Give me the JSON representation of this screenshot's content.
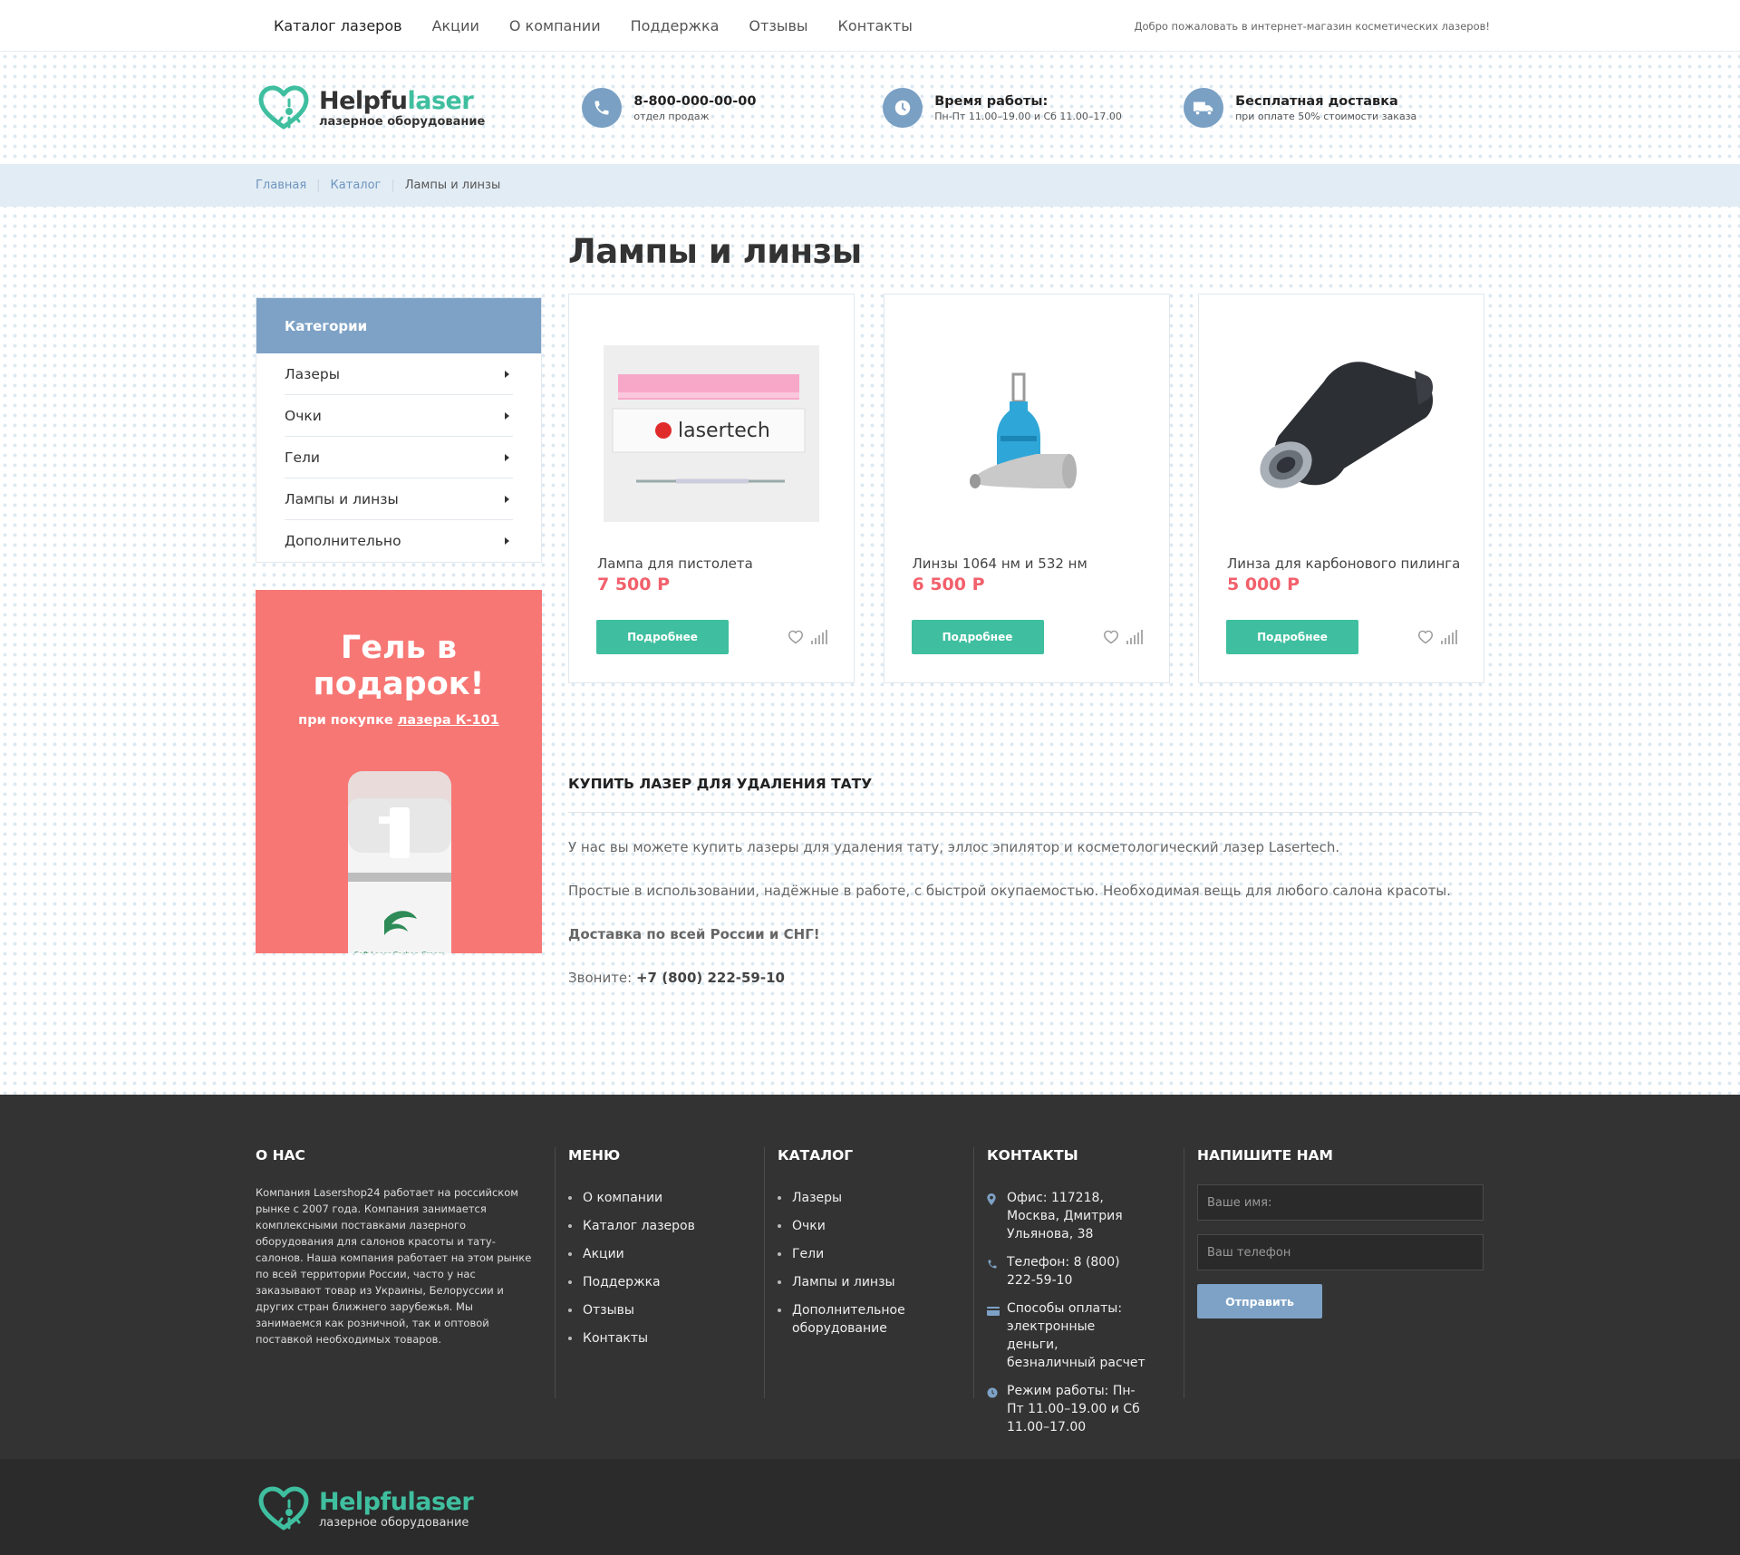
{
  "topnav": {
    "items": [
      "Каталог лазеров",
      "Акции",
      "О компании",
      "Поддержка",
      "Отзывы",
      "Контакты"
    ],
    "welcome": "Добро пожаловать в интернет-магазин косметических лазеров!"
  },
  "brand": {
    "name_a": "Helpfu",
    "name_b": "laser",
    "tagline": "лазерное оборудование",
    "accent": "#3fbf9f"
  },
  "header_info": [
    {
      "icon": "phone-icon",
      "title": "8-800-000-00-00",
      "sub": "отдел продаж"
    },
    {
      "icon": "clock-icon",
      "title": "Время работы:",
      "sub": "Пн-Пт 11.00–19.00 и Сб 11.00–17.00"
    },
    {
      "icon": "truck-icon",
      "title": "Бесплатная доставка",
      "sub": "при оплате 50% стоимости заказа"
    }
  ],
  "breadcrumb": {
    "home": "Главная",
    "catalog": "Каталог",
    "current": "Лампы и линзы"
  },
  "page_title": "Лампы и линзы",
  "categories": {
    "title": "Категории",
    "items": [
      "Лазеры",
      "Очки",
      "Гели",
      "Лампы и линзы",
      "Дополнительно"
    ]
  },
  "promo": {
    "line1": "Гель в",
    "line2": "подарок!",
    "sub_pre": "при покупке ",
    "sub_link": "лазера К-101",
    "color": "#f77774"
  },
  "products": [
    {
      "name": "Лампа для пистолета",
      "price": "7 500 Р",
      "button": "Подробнее",
      "brand_text": "lasertech"
    },
    {
      "name": "Линзы 1064 нм и 532 нм",
      "price": "6 500 Р",
      "button": "Подробнее"
    },
    {
      "name": "Линза для карбонового пилинга",
      "price": "5 000 Р",
      "button": "Подробнее"
    }
  ],
  "about": {
    "heading": "КУПИТЬ ЛАЗЕР ДЛЯ УДАЛЕНИЯ ТАТУ",
    "p1": "У нас вы можете купить лазеры для удаления тату, эллос эпилятор и косметологический лазер Lasertech.",
    "p2": "Простые в использовании, надёжные в работе, с быстрой окупаемостью. Необходимая вещь для любого салона красоты.",
    "p3": "Доставка по всей России и СНГ!",
    "call_label": "Звоните: ",
    "call_phone": "+7 (800) 222-59-10"
  },
  "footer": {
    "about_title": "О НАС",
    "about_text": "Компания Lasershop24 работает на российском рынке с 2007 года. Компания занимается комплексными поставками лазерного оборудования для салонов красоты и тату-салонов. Наша компания работает на этом рынке по всей территории России, часто у нас заказывают товар из Украины, Белоруссии и других стран ближнего зарубежья. Мы занимаемся как розничной, так и оптовой поставкой необходимых товаров.",
    "menu_title": "МЕНЮ",
    "menu": [
      "О компании",
      "Каталог лазеров",
      "Акции",
      "Поддержка",
      "Отзывы",
      "Контакты"
    ],
    "catalog_title": "КАТАЛОГ",
    "catalog": [
      "Лазеры",
      "Очки",
      "Гели",
      "Лампы и линзы",
      "Дополнительное оборудование"
    ],
    "contacts_title": "КОНТАКТЫ",
    "contacts": [
      {
        "icon": "map-pin-icon",
        "text": "Офис: 117218, Москва, Дмитрия Ульянова, 38"
      },
      {
        "icon": "phone-icon",
        "text": "Телефон: 8 (800) 222-59-10"
      },
      {
        "icon": "card-icon",
        "text": "Способы оплаты: электронные деньги, безналичный расчет"
      },
      {
        "icon": "clock-icon",
        "text": "Режим работы: Пн-Пт 11.00–19.00 и Сб 11.00–17.00"
      }
    ],
    "write_title": "НАПИШИТЕ НАМ",
    "name_placeholder": "Ваше имя:",
    "phone_placeholder": "Ваш телефон",
    "send": "Отправить"
  }
}
